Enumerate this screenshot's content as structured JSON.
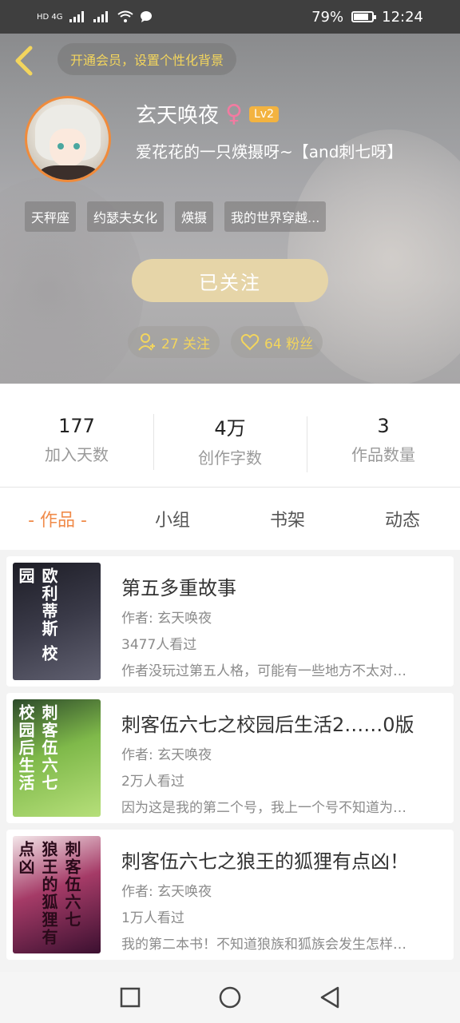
{
  "status_bar": {
    "network_left": "HD 4G",
    "battery": "79%",
    "time": "12:24"
  },
  "header": {
    "vip_banner": "开通会员，设置个性化背景",
    "username": "玄天唤夜",
    "gender_symbol": "♀",
    "level": "Lv2",
    "bio": "爱花花的一只煐摄呀~【and刺七呀】",
    "tags": [
      "天秤座",
      "约瑟夫女化",
      "煐摄",
      "我的世界穿越..."
    ],
    "follow_button": "已关注",
    "following": "27 关注",
    "fans": "64 粉丝"
  },
  "stats": [
    {
      "value": "177",
      "label": "加入天数"
    },
    {
      "value": "4万",
      "label": "创作字数"
    },
    {
      "value": "3",
      "label": "作品数量"
    }
  ],
  "tabs": [
    "- 作品 -",
    "小组",
    "书架",
    "动态"
  ],
  "works": [
    {
      "title": "第五多重故事",
      "author": "作者: 玄天唤夜",
      "views": "3477人看过",
      "desc": "作者没玩过第五人格，可能有一些地方不太对…",
      "cover_text": "欧利蒂斯 校园"
    },
    {
      "title": "刺客伍六七之校园后生活2……0版",
      "author": "作者: 玄天唤夜",
      "views": "2万人看过",
      "desc": "因为这是我的第二个号，我上一个号不知道为…",
      "cover_text": "刺客伍六七 校园后生活"
    },
    {
      "title": "刺客伍六七之狼王的狐狸有点凶！",
      "author": "作者: 玄天唤夜",
      "views": "1万人看过",
      "desc": "我的第二本书！不知道狼族和狐族会发生怎样…",
      "cover_text": "刺客伍六七 狼王的狐狸有点凶"
    }
  ]
}
